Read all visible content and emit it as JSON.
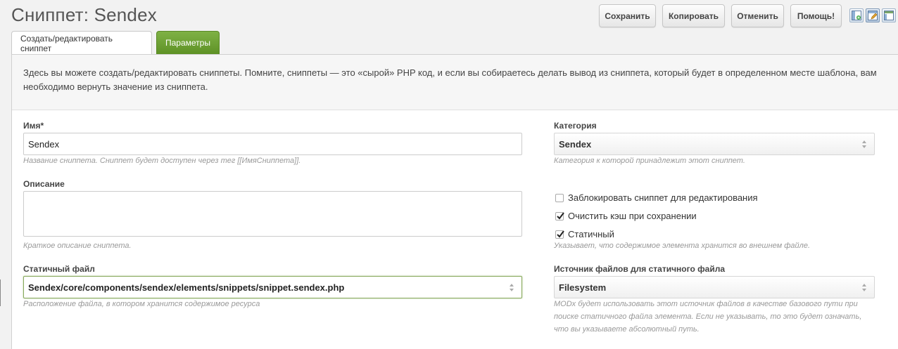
{
  "page": {
    "title": "Сниппет: Sendex"
  },
  "toolbar": {
    "save_label": "Сохранить",
    "copy_label": "Копировать",
    "cancel_label": "Отменить",
    "help_label": "Помощь!",
    "layout_icons": [
      "layout-left-icon",
      "layout-edit-icon",
      "layout-top-icon"
    ]
  },
  "tabs": [
    {
      "label": "Создать/редактировать сниппет",
      "active": true
    },
    {
      "label": "Параметры",
      "active": false
    }
  ],
  "intro": "Здесь вы можете создать/редактировать сниппеты. Помните, сниппеты — это «сырой» PHP код, и если вы собираетесь делать вывод из сниппета, который будет в определенном месте шаблона, вам необходимо вернуть значение из сниппета.",
  "form": {
    "name": {
      "label": "Имя*",
      "value": "Sendex",
      "hint": "Название сниппета. Сниппет будет доступен через тег [[ИмяСниппета]]."
    },
    "category": {
      "label": "Категория",
      "value": "Sendex",
      "hint": "Категория к которой принадлежит этот сниппет."
    },
    "description": {
      "label": "Описание",
      "value": "",
      "hint": "Краткое описание сниппета."
    },
    "lock": {
      "label": "Заблокировать сниппет для редактирования",
      "checked": false
    },
    "clear_cache": {
      "label": "Очистить кэш при сохранении",
      "checked": true
    },
    "static": {
      "label": "Статичный",
      "checked": true,
      "hint": "Указывает, что содержимое элемента хранится во внешнем файле."
    },
    "static_file": {
      "label": "Статичный файл",
      "value": "Sendex/core/components/sendex/elements/snippets/snippet.sendex.php",
      "hint": "Расположение файла, в котором хранится содержимое ресурса"
    },
    "source": {
      "label": "Источник файлов для статичного файла",
      "value": "Filesystem",
      "hint_lines": [
        "MODx будет использовать этот источник файлов в качестве базового пути при",
        "поиске статичного файла элемента. Если не указывать, то это будет означать,",
        "что вы указываете абсолютный путь."
      ]
    }
  },
  "colors": {
    "accent_green": "#6a9e30",
    "focus_border": "#86a85a"
  }
}
